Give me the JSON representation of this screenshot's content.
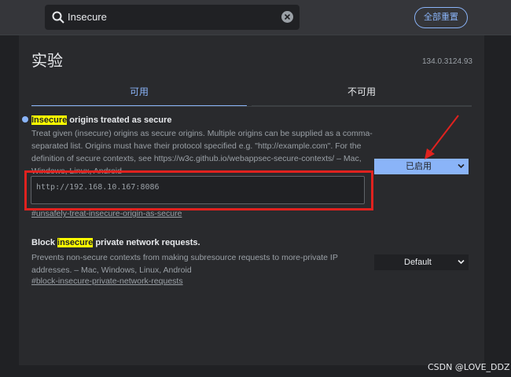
{
  "header": {
    "search": {
      "value": "Insecure"
    },
    "reset_label": "全部重置"
  },
  "page": {
    "title": "实验",
    "version": "134.0.3124.93"
  },
  "tabs": [
    {
      "label": "可用",
      "active": true
    },
    {
      "label": "不可用",
      "active": false
    }
  ],
  "experiments": [
    {
      "title_highlight": "Insecure",
      "title_rest": " origins treated as secure",
      "description_lines": [
        "Treat given (insecure) origins as secure origins. Multiple origins can be supplied as a comma-",
        "separated list. Origins must have their protocol specified e.g. \"http://example.com\". For the",
        "definition of secure contexts, see https://w3c.github.io/webappsec-secure-contexts/ – Mac,",
        "Windows, Linux, Android"
      ],
      "input_value": "http://192.168.10.167:8086",
      "link": "#unsafely-treat-insecure-origin-as-secure",
      "select_value": "已启用"
    },
    {
      "title_pre": "Block ",
      "title_highlight": "insecure",
      "title_rest": " private network requests.",
      "description_lines": [
        "Prevents non-secure contexts from making subresource requests to more-private IP",
        "addresses. – Mac, Windows, Linux, Android"
      ],
      "link": "#block-insecure-private-network-requests",
      "select_value": "Default"
    }
  ],
  "watermark": "CSDN @LOVE_DDZ",
  "colors": {
    "accent": "#8ab4f8",
    "highlight": "#ffff00",
    "annotation_red": "#e0221f"
  }
}
